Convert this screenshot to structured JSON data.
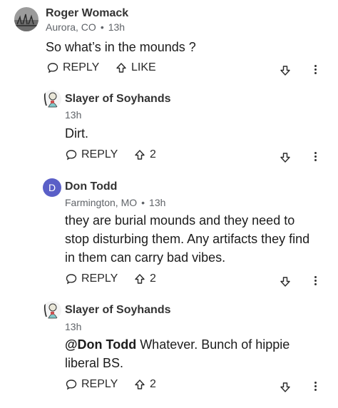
{
  "comments": [
    {
      "author": "Roger Womack",
      "location": "Aurora, CO",
      "time": "13h",
      "text": "So what’s in the mounds ?",
      "reply_label": "REPLY",
      "like_label": "LIKE"
    },
    {
      "author": "Slayer of Soyhands",
      "time": "13h",
      "text": "Dirt.",
      "reply_label": "REPLY",
      "likes": "2"
    },
    {
      "author": "Don Todd",
      "avatar_letter": "D",
      "location": "Farmington, MO",
      "time": "13h",
      "text": "they are burial mounds and they need to stop disturbing them. Any artifacts they find in them can carry bad vibes.",
      "reply_label": "REPLY",
      "likes": "2"
    },
    {
      "author": "Slayer of Soyhands",
      "time": "13h",
      "mention": "@Don Todd",
      "text": " Whatever. Bunch of hippie liberal BS.",
      "reply_label": "REPLY",
      "likes": "2"
    }
  ],
  "meta_separator": "•",
  "colors": {
    "avatar_letter_bg": "#5a5fc7",
    "text": "#1c1c1c",
    "meta": "#5f6368"
  }
}
